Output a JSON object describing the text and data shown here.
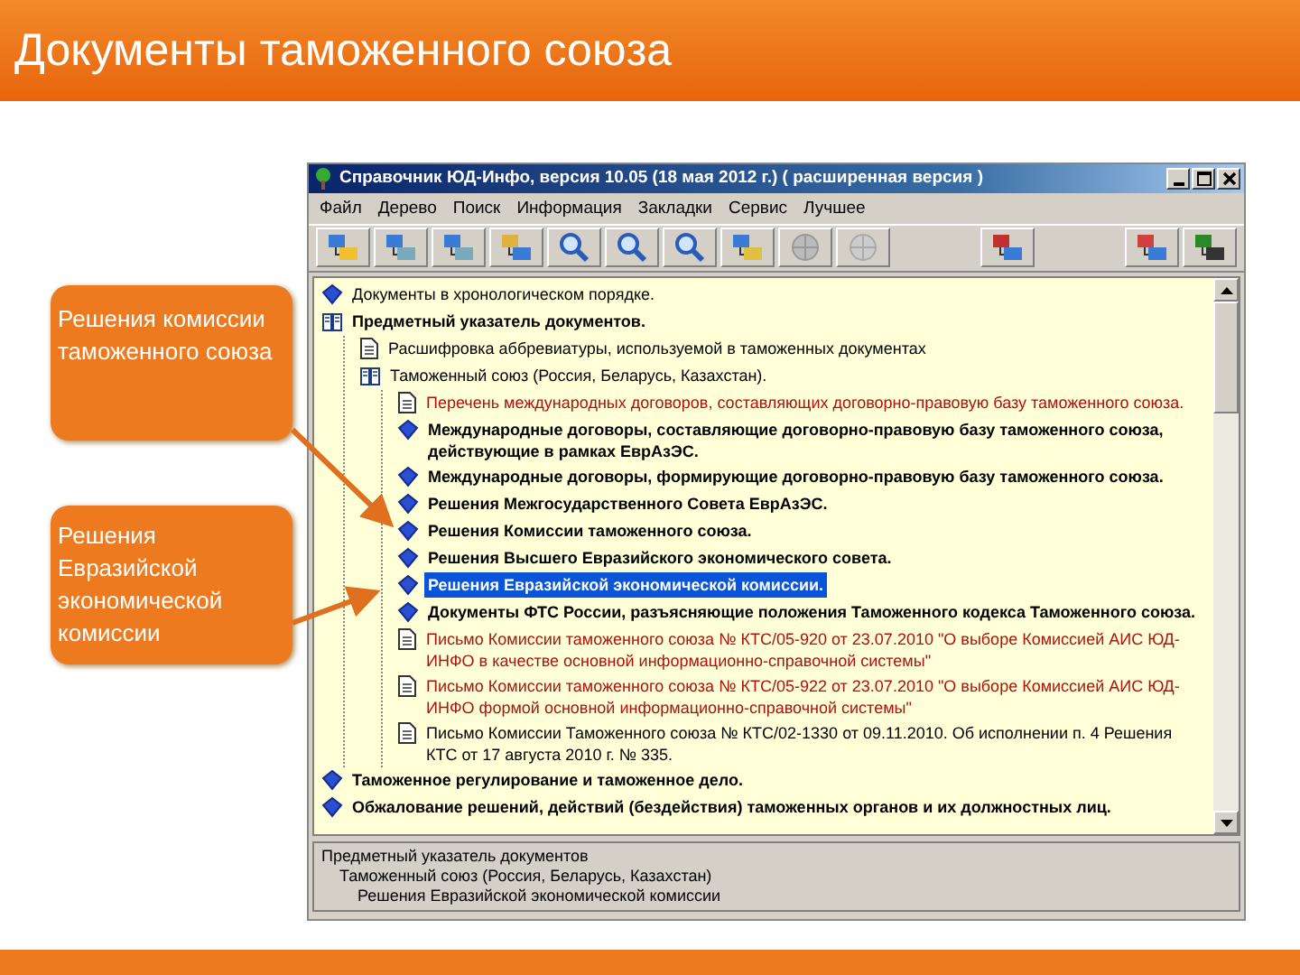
{
  "slide_title": "Документы таможенного союза",
  "callouts": [
    "Решения комиссии таможенного союза",
    "Решения Евразийской экономической комиссии"
  ],
  "window": {
    "title": "Справочник ЮД-Инфо, версия 10.05 (18 мая 2012 г.)  ( расширенная версия )",
    "menu": [
      "Файл",
      "Дерево",
      "Поиск",
      "Информация",
      "Закладки",
      "Сервис",
      "Лучшее"
    ],
    "tree": [
      {
        "kind": "book",
        "label": "Документы в хронологическом порядке.",
        "bold": false,
        "color": "#000000",
        "selected": false
      },
      {
        "kind": "open-book",
        "label": "Предметный указатель документов.",
        "bold": true,
        "color": "#000000",
        "selected": false,
        "children": [
          {
            "kind": "document",
            "label": "Расшифровка аббревиатуры, используемой в таможенных документах",
            "bold": false,
            "color": "#000000",
            "selected": false
          },
          {
            "kind": "open-book",
            "label": "Таможенный союз (Россия, Беларусь, Казахстан).",
            "bold": false,
            "color": "#000000",
            "selected": false,
            "children": [
              {
                "kind": "document",
                "label": "Перечень международных договоров, составляющих договорно-правовую базу таможенного союза.",
                "bold": false,
                "color": "#b01010",
                "selected": false
              },
              {
                "kind": "book",
                "label": "Международные договоры, составляющие договорно-правовую базу таможенного союза, действующие в рамках ЕврАзЭС.",
                "bold": true,
                "color": "#000000",
                "selected": false
              },
              {
                "kind": "book",
                "label": "Международные договоры, формирующие договорно-правовую базу таможенного союза.",
                "bold": true,
                "color": "#000000",
                "selected": false
              },
              {
                "kind": "book",
                "label": "Решения Межгосударственного Совета ЕврАзЭС.",
                "bold": true,
                "color": "#000000",
                "selected": false
              },
              {
                "kind": "book",
                "label": "Решения Комиссии таможенного союза.",
                "bold": true,
                "color": "#000000",
                "selected": false
              },
              {
                "kind": "book",
                "label": "Решения Высшего Евразийского экономического совета.",
                "bold": true,
                "color": "#000000",
                "selected": false
              },
              {
                "kind": "book",
                "label": "Решения Евразийской экономической комиссии.",
                "bold": true,
                "selected": true
              },
              {
                "kind": "book",
                "label": "Документы ФТС России, разъясняющие положения Таможенного кодекса Таможенного союза.",
                "bold": true,
                "color": "#000000",
                "selected": false
              },
              {
                "kind": "document",
                "label": "Письмо Комиссии таможенного союза № КТС/05-920 от 23.07.2010 \"О выборе Комиссией АИС ЮД-ИНФО в качестве основной информационно-справочной системы\"",
                "bold": false,
                "color": "#b01010",
                "selected": false
              },
              {
                "kind": "document",
                "label": "Письмо Комиссии таможенного союза № КТС/05-922 от 23.07.2010 \"О выборе Комиссией АИС ЮД-ИНФО формой основной информационно-справочной системы\"",
                "bold": false,
                "color": "#b01010",
                "selected": false
              },
              {
                "kind": "document",
                "label": "Письмо Комиссии Таможенного союза № КТС/02-1330 от 09.11.2010. Об исполнении п. 4 Решения КТС от 17 августа 2010 г. № 335.",
                "bold": false,
                "color": "#000000",
                "selected": false
              }
            ]
          }
        ]
      },
      {
        "kind": "book",
        "label": "Таможенное регулирование и таможенное дело.",
        "bold": true,
        "color": "#000000",
        "selected": false
      },
      {
        "kind": "book",
        "label": "Обжалование решений, действий (бездействия) таможенных органов и их должностных лиц.",
        "bold": true,
        "color": "#000000",
        "selected": false
      }
    ],
    "path": [
      "Предметный указатель документов",
      "Таможенный союз (Россия, Беларусь, Казахстан)",
      "Решения Евразийской экономической комиссии"
    ]
  }
}
